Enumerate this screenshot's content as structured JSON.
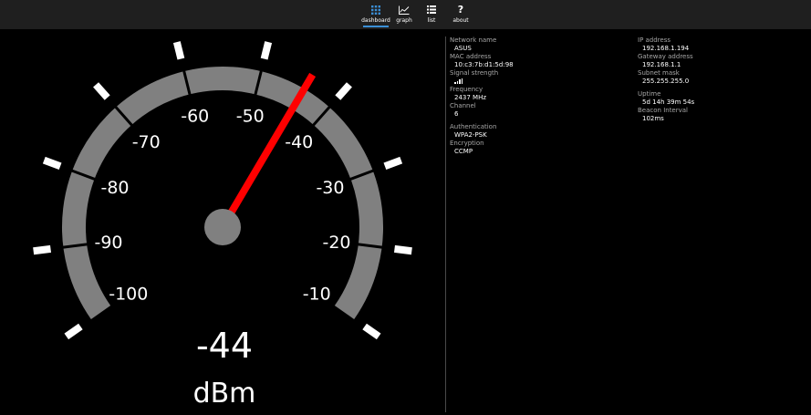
{
  "nav": {
    "items": [
      {
        "label": "dashboard",
        "icon": "grid-icon",
        "active": true
      },
      {
        "label": "graph",
        "icon": "line-graph-icon",
        "active": false
      },
      {
        "label": "list",
        "icon": "list-icon",
        "active": false
      },
      {
        "label": "about",
        "icon": "question-icon",
        "active": false
      }
    ]
  },
  "gauge": {
    "ticks": [
      "-100",
      "-90",
      "-80",
      "-70",
      "-60",
      "-50",
      "-40",
      "-30",
      "-20",
      "-10"
    ],
    "min": -100,
    "max": -10,
    "value": -44,
    "reading": "-44",
    "unit": "dBm",
    "needle_color": "#ff0000",
    "arc_color": "#808080"
  },
  "details": {
    "left": [
      {
        "key": "Network name",
        "value": "ASUS"
      },
      {
        "key": "MAC address",
        "value": "10:c3:7b:d1:5d:98"
      },
      {
        "key": "Signal strength",
        "value": "",
        "icon": "signal-bars-icon",
        "bars": 4
      },
      {
        "key": "Frequency",
        "value": "2437 MHz"
      },
      {
        "key": "Channel",
        "value": "6"
      },
      {
        "key": "Authentication",
        "value": "WPA2-PSK"
      },
      {
        "key": "Encryption",
        "value": "CCMP"
      }
    ],
    "right": [
      {
        "key": "IP address",
        "value": "192.168.1.194"
      },
      {
        "key": "Gateway address",
        "value": "192.168.1.1"
      },
      {
        "key": "Subnet mask",
        "value": "255.255.255.0"
      },
      {
        "key": "Uptime",
        "value": "5d 14h 39m 54s"
      },
      {
        "key": "Beacon Interval",
        "value": "102ms"
      }
    ]
  }
}
